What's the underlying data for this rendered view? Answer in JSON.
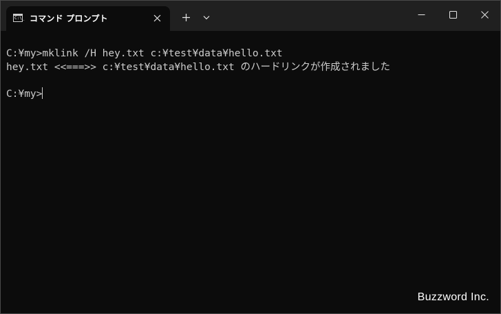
{
  "window": {
    "tab_title": "コマンド プロンプト",
    "tab_icon": "cmd-icon",
    "tab_icon_text": "C:\\_",
    "buttons": {
      "close_tab": "close-icon",
      "new_tab": "plus-icon",
      "dropdown": "chevron-down-icon",
      "minimize": "minimize-icon",
      "maximize": "maximize-icon",
      "close": "close-icon"
    }
  },
  "terminal": {
    "lines": [
      "C:¥my>mklink /H hey.txt c:¥test¥data¥hello.txt",
      "hey.txt <<===>> c:¥test¥data¥hello.txt のハードリンクが作成されました"
    ],
    "prompt": "C:¥my>"
  },
  "watermark": "Buzzword Inc.",
  "colors": {
    "background": "#0c0c0c",
    "titlebar": "#202020",
    "text": "#cccccc"
  }
}
